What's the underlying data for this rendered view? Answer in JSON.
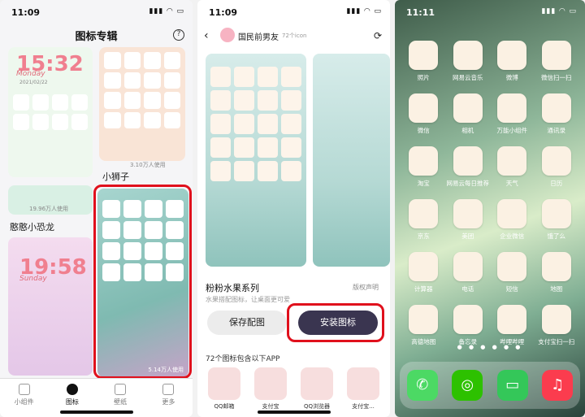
{
  "screen1": {
    "time": "11:09",
    "title": "图标专辑",
    "help_icon": "question-circle-icon",
    "card1_clock": "15:32",
    "card1_day": "Monday",
    "card1_date": "2021/02/22",
    "card2_label": "小狮子",
    "card2_users": "3.10万人使用",
    "card3_label": "憨憨小恐龙",
    "card3_users": "19.96万人使用",
    "card4_clock": "19:58",
    "card4_day": "Sunday",
    "card5_users": "5.14万人使用",
    "tabs": [
      {
        "label": "小组件",
        "icon": "widget-icon"
      },
      {
        "label": "图标",
        "icon": "grid-icon"
      },
      {
        "label": "壁纸",
        "icon": "image-icon"
      },
      {
        "label": "更多",
        "icon": "more-icon"
      }
    ],
    "highlight_color": "#e0101c"
  },
  "screen2": {
    "time": "11:09",
    "author": "国民前男友",
    "icon_count": "72个icon",
    "series_title": "粉粉水果系列",
    "copyright": "版权声明",
    "description": "水果搭配图标，让桌面更可爱",
    "save_button": "保存配图",
    "install_button": "安装图标",
    "apps_heading": "72个图标包含以下APP",
    "apps": [
      "QQ邮箱",
      "支付宝",
      "QQ浏览器",
      "支付宝..."
    ],
    "accent_color": "#3a3550"
  },
  "screen3": {
    "time": "11:11",
    "apps": [
      "照片",
      "网易云音乐",
      "微博",
      "微信扫一扫",
      "微信",
      "相机",
      "万能小组件",
      "通讯录",
      "淘宝",
      "网易云每日推荐",
      "天气",
      "日历",
      "京东",
      "美团",
      "企业微信",
      "饿了么",
      "计算器",
      "电话",
      "短信",
      "地图",
      "高德地图",
      "备忘录",
      "哔哩哔哩",
      "支付宝扫一扫"
    ],
    "dock": [
      "phone-icon",
      "wechat-icon",
      "messages-icon",
      "music-icon"
    ],
    "page_dots": "● ● ● ● ● ●"
  }
}
